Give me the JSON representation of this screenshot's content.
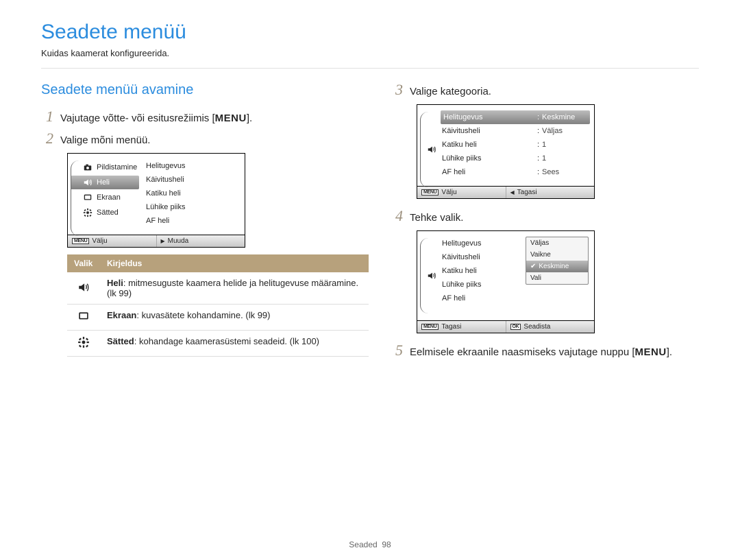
{
  "page_title": "Seadete menüü",
  "intro": "Kuidas kaamerat konfigureerida.",
  "section_title": "Seadete menüü avamine",
  "menu_button_label": "MENU",
  "steps": {
    "1": "Vajutage võtte- või esitusrežiimis [",
    "1_after": "].",
    "2": "Valige mõni menüü.",
    "3": "Valige kategooria.",
    "4": "Tehke valik.",
    "5_before": "Eelmisele ekraanile naasmiseks vajutage nuppu [",
    "5_after": "]."
  },
  "screen_a": {
    "sidebar": [
      {
        "icon": "camera",
        "label": "Pildistamine"
      },
      {
        "icon": "speaker",
        "label": "Heli",
        "selected": true
      },
      {
        "icon": "display",
        "label": "Ekraan"
      },
      {
        "icon": "gear",
        "label": "Sätted"
      }
    ],
    "right": [
      "Helitugevus",
      "Käivitusheli",
      "Katiku heli",
      "Lühike piiks",
      "AF heli"
    ],
    "footer_left_icon": "MENU",
    "footer_left": "Välju",
    "footer_right_icon": "▶",
    "footer_right": "Muuda"
  },
  "screen_b": {
    "icon_row": "speaker",
    "items": [
      {
        "label": "Helitugevus",
        "value": "Keskmine",
        "selected": true
      },
      {
        "label": "Käivitusheli",
        "value": "Väljas"
      },
      {
        "label": "Katiku heli",
        "value": "1"
      },
      {
        "label": "Lühike piiks",
        "value": "1"
      },
      {
        "label": "AF heli",
        "value": "Sees"
      }
    ],
    "footer_left_icon": "MENU",
    "footer_left": "Välju",
    "footer_right_icon": "◀",
    "footer_right": "Tagasi"
  },
  "screen_c": {
    "icon_row": "speaker",
    "items": [
      "Helitugevus",
      "Käivitusheli",
      "Katiku heli",
      "Lühike piiks",
      "AF heli"
    ],
    "dropdown": [
      {
        "label": "Väljas"
      },
      {
        "label": "Vaikne"
      },
      {
        "label": "Keskmine",
        "selected": true,
        "check": true
      },
      {
        "label": "Vali"
      }
    ],
    "footer_left_icon": "MENU",
    "footer_left": "Tagasi",
    "footer_right_icon": "OK",
    "footer_right": "Seadista"
  },
  "table": {
    "head_option": "Valik",
    "head_desc": "Kirjeldus",
    "rows": [
      {
        "icon": "speaker",
        "title": "Heli",
        "desc": ": mitmesuguste kaamera helide ja helitugevuse määramine. (lk 99)"
      },
      {
        "icon": "display",
        "title": "Ekraan",
        "desc": ": kuvasätete kohandamine. (lk 99)"
      },
      {
        "icon": "gear",
        "title": "Sätted",
        "desc": ": kohandage kaamerasüstemi seadeid. (lk 100)"
      }
    ]
  },
  "footer": {
    "section": "Seaded",
    "page": "98"
  }
}
